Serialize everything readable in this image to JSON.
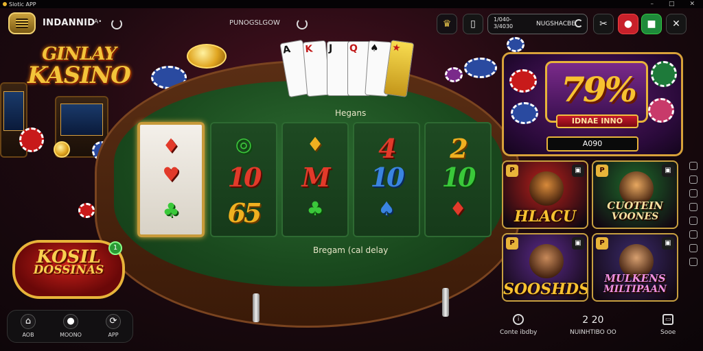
{
  "status": {
    "app_label": "Slotic APP",
    "icons": [
      "minimize-icon",
      "maximize-icon",
      "close-icon"
    ]
  },
  "topbar": {
    "brand": "INDANNID",
    "brand_suffix": "A•",
    "center_label": "PUNOGSLGOW",
    "btn1_glyph": "♛",
    "btn2_glyph": "▯",
    "balance_label_line1": "1/040-",
    "balance_label_line2": "3/4030",
    "balance_value": "NUGSHACBE",
    "btn_tools_glyph": "✂",
    "btn_red_glyph": "●",
    "btn_green_glyph": "■",
    "btn_close_glyph": "✕"
  },
  "left": {
    "logo_line1": "GINLAY",
    "logo_line2": "KASINO"
  },
  "table": {
    "felt_top": "Hegans",
    "felt_bottom": "Bregam (cal delay",
    "reels": [
      {
        "symbols": [
          {
            "t": "♦",
            "cls": "c-red ico"
          },
          {
            "t": "♥",
            "cls": "c-red ico"
          },
          {
            "t": "♣",
            "cls": "c-green ico"
          }
        ]
      },
      {
        "symbols": [
          {
            "t": "◎",
            "cls": "c-green ico"
          },
          {
            "t": "10",
            "cls": "c-red num"
          },
          {
            "t": "65",
            "cls": "c-gold num"
          }
        ]
      },
      {
        "symbols": [
          {
            "t": "♦",
            "cls": "c-gold ico"
          },
          {
            "t": "M",
            "cls": "c-red num"
          },
          {
            "t": "♣",
            "cls": "c-green ico"
          }
        ]
      },
      {
        "symbols": [
          {
            "t": "4",
            "cls": "c-red num"
          },
          {
            "t": "10",
            "cls": "c-blue num"
          },
          {
            "t": "♠",
            "cls": "c-blue ico"
          }
        ]
      },
      {
        "symbols": [
          {
            "t": "2",
            "cls": "c-gold num"
          },
          {
            "t": "10",
            "cls": "c-green num"
          },
          {
            "t": "♦",
            "cls": "c-red ico"
          }
        ]
      }
    ],
    "fan_cards": [
      "A",
      "K",
      "J",
      "Q",
      "♠",
      "★"
    ]
  },
  "promo": {
    "line1": "KOSIL",
    "line2": "DOSSINAS",
    "badge": "1"
  },
  "bottom_nav": [
    {
      "icon": "home-icon",
      "glyph": "⌂",
      "label": "AOB"
    },
    {
      "icon": "chip-icon",
      "glyph": "●",
      "label": "MOONO"
    },
    {
      "icon": "app-icon",
      "glyph": "⟳",
      "label": "APP"
    }
  ],
  "jackpot": {
    "value": "79%",
    "subtitle": "IDNAE INNO",
    "bar_value": "A090"
  },
  "tiles": [
    {
      "title_l1": "HLACU",
      "title_l2": "",
      "bg": "#b8201a",
      "face": "#d88a3a",
      "color": "#f8c230",
      "corner": "P",
      "corner_r": "▣"
    },
    {
      "title_l1": "CUOTEIN",
      "title_l2": "VOONES",
      "bg": "#1e6a2a",
      "face": "#e8a860",
      "color": "#f8e0a0",
      "corner": "P",
      "corner_r": "▣"
    },
    {
      "title_l1": "SOOSHDS",
      "title_l2": "",
      "bg": "#5a2a8a",
      "face": "#c88a5a",
      "color": "#f8c230",
      "corner": "P",
      "corner_r": "▣"
    },
    {
      "title_l1": "MULKENS",
      "title_l2": "MILTIPAAN",
      "bg": "#3a2a6a",
      "face": "#d8a070",
      "color": "#f090e0",
      "corner": "P",
      "corner_r": "▣"
    }
  ],
  "bottom_right": {
    "item1_label": "Conte ibdby",
    "item2_num": "2 20",
    "item2_label": "NUINHTIBO OO",
    "item3_label": "Sooe"
  }
}
